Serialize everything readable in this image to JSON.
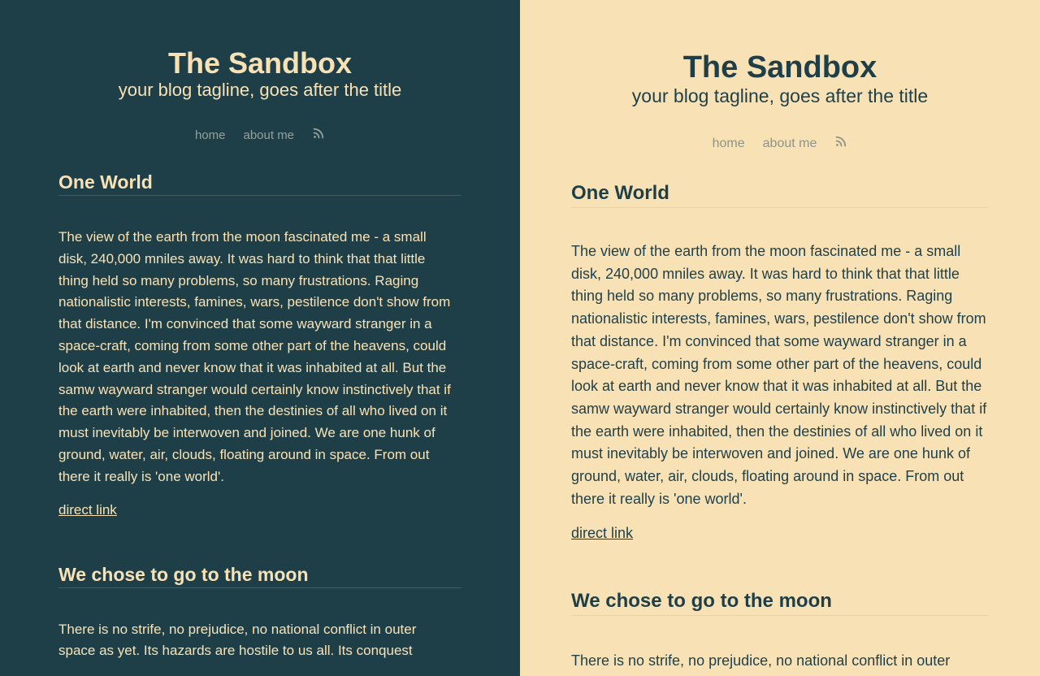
{
  "site": {
    "title": "The Sandbox",
    "tagline": "your blog tagline, goes after the title"
  },
  "nav": {
    "items": [
      {
        "label": "home"
      },
      {
        "label": "about me"
      }
    ],
    "rss_icon": "rss-icon"
  },
  "posts": [
    {
      "title": "One World",
      "body": "The view of the earth from the moon fascinated me - a small disk, 240,000 mniles away. It was hard to think that that little thing held so many problems, so many frustrations. Raging nationalistic interests, famines, wars, pestilence don't show from that distance. I'm convinced that some wayward stranger in a space-craft, coming from some other part of the heavens, could look at earth and never know that it was inhabited at all. But the samw wayward stranger would certainly know instinctively that if the earth were inhabited, then the destinies of all who lived on it must inevitably be interwoven and joined. We are one hunk of ground, water, air, clouds, floating around in space. From out there it really is 'one world'.",
      "link": "direct link"
    },
    {
      "title": "We chose to go to the moon",
      "body": "There is no strife, no prejudice, no national conflict in outer space as yet. Its hazards are hostile to us all. Its conquest"
    }
  ],
  "colors": {
    "dark_bg": "#1f3f48",
    "light_bg": "#f8e2b5",
    "nav_dark": "#93a09e",
    "nav_light": "#8e948a"
  }
}
